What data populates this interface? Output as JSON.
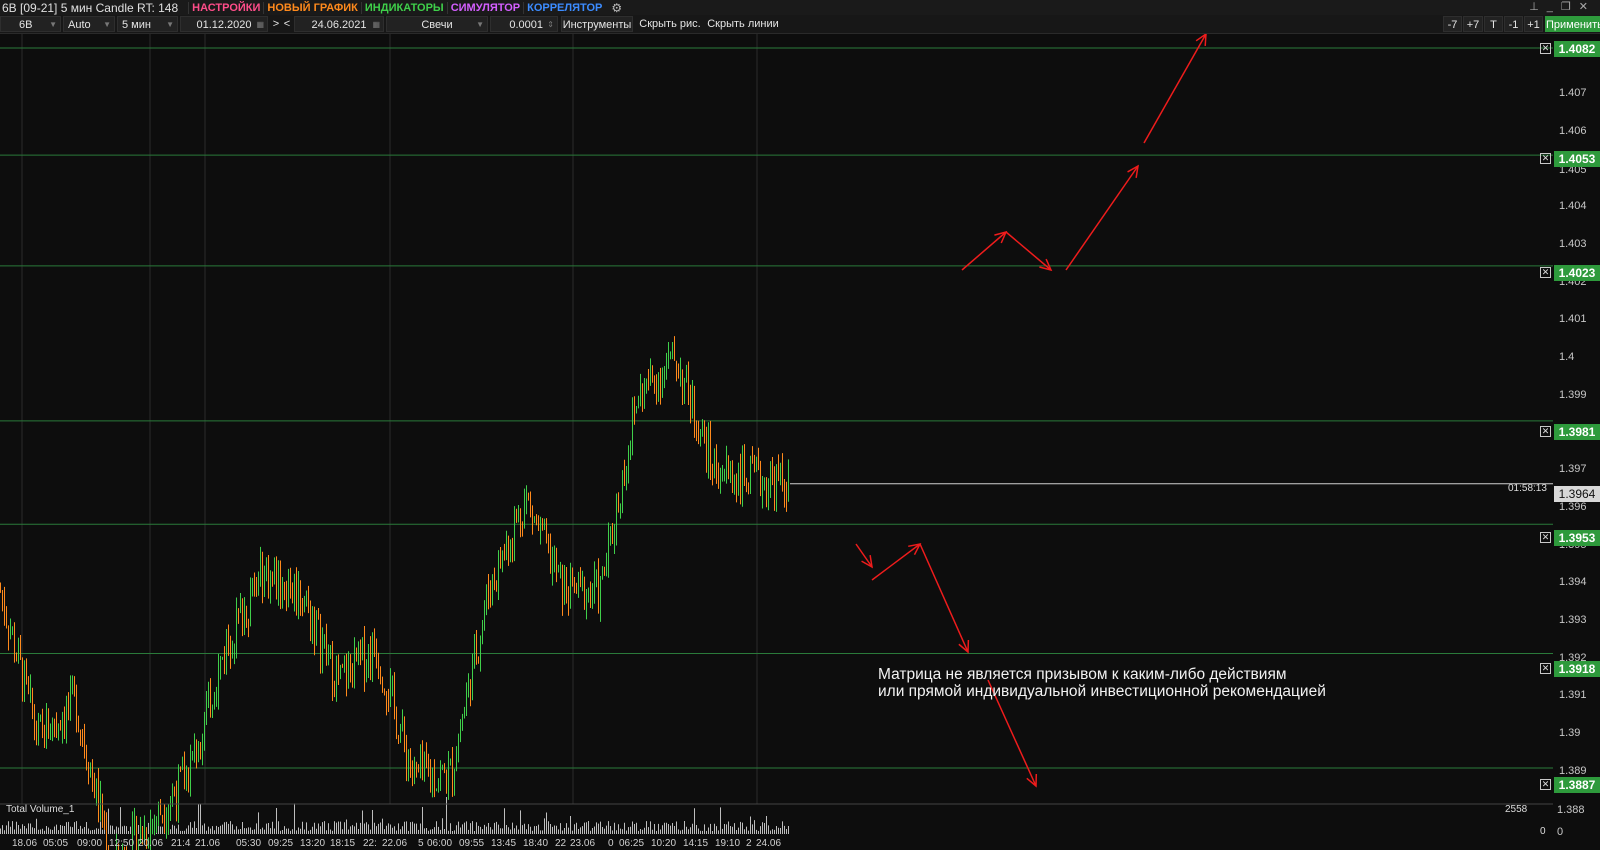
{
  "window": {
    "title": "6B [09-21] 5 мин Candle RT: 148",
    "menu": [
      {
        "label": "НАСТРОЙКИ",
        "color": "#ff4d8a"
      },
      {
        "label": "НОВЫЙ ГРАФИК",
        "color": "#ff8a1c"
      },
      {
        "label": "ИНДИКАТОРЫ",
        "color": "#3fcf4a"
      },
      {
        "label": "СИМУЛЯТОР",
        "color": "#d45fff"
      },
      {
        "label": "КОРРЕЛЯТОР",
        "color": "#3c8cff"
      }
    ],
    "settings_icon": "gears-icon",
    "controls": [
      "pin-icon",
      "minimize-icon",
      "restore-icon",
      "close-icon"
    ]
  },
  "toolbar": {
    "symbol": "6B",
    "scale": "Auto",
    "timeframe": "5 мин",
    "date_from": "01.12.2020",
    "nav_next": ">",
    "nav_prev": "<",
    "date_to": "24.06.2021",
    "chart_type": "Свечи",
    "tick_size": "0.0001",
    "tools_label": "Инструменты",
    "hide_drawings": "Скрыть рис.",
    "hide_lines": "Скрыть линии",
    "step_buttons": [
      "-7",
      "+7",
      "T",
      "-1",
      "+1"
    ],
    "apply_label": "Применить"
  },
  "price_axis": {
    "ticks": [
      "1.407",
      "1.406",
      "1.405",
      "1.404",
      "1.403",
      "1.402",
      "1.401",
      "1.4",
      "1.399",
      "1.397",
      "1.396",
      "1.395",
      "1.394",
      "1.393",
      "1.392",
      "1.391",
      "1.39",
      "1.389"
    ],
    "levels": [
      "1.4082",
      "1.4053",
      "1.4023",
      "1.3981",
      "1.3953",
      "1.3918",
      "1.3887"
    ],
    "current_price": "1.3964",
    "timer": "01:58:13"
  },
  "volume": {
    "label": "Total Volume_1",
    "max": "2558",
    "min": "0",
    "axis_ticks": [
      "1.388",
      "0"
    ]
  },
  "time_axis": [
    "18.06",
    "05:05",
    "09:00",
    "12:50",
    "20.06",
    "21:4",
    "21.06",
    "05:30",
    "09:25",
    "13:20",
    "18:15",
    "22:",
    "22.06",
    "5",
    "06:00",
    "09:55",
    "13:45",
    "18:40",
    "22",
    "23.06",
    "0",
    "06:25",
    "10:20",
    "14:15",
    "19:10",
    "2",
    "24.06"
  ],
  "disclaimer": {
    "line1": "Матрица не является призывом к каким-либо действиям",
    "line2": "или прямой индивидуальной инвестиционной рекомендацией"
  },
  "colors": {
    "level_badge": "#2e9a3c",
    "level_line": "#2a7a3a",
    "arrow": "#ee1c1c",
    "candle_up": "#3fcf4a",
    "candle_down": "#ff8a1c"
  },
  "chart_data": {
    "type": "candlestick",
    "instrument": "6B [09-21]",
    "timeframe": "5 мин",
    "y_axis_range": [
      1.388,
      1.4085
    ],
    "support_resistance_levels": [
      1.4082,
      1.4053,
      1.4023,
      1.3981,
      1.3953,
      1.3918,
      1.3887
    ],
    "current_price": 1.3964,
    "price_path_approx": [
      {
        "x": "18.06",
        "y": 1.3935
      },
      {
        "x": "05:05",
        "y": 1.3895
      },
      {
        "x": "09:00",
        "y": 1.3905
      },
      {
        "x": "12:50",
        "y": 1.386
      },
      {
        "x": "21.06",
        "y": 1.3872
      },
      {
        "x": "05:30",
        "y": 1.3885
      },
      {
        "x": "09:25",
        "y": 1.392
      },
      {
        "x": "13:20",
        "y": 1.394
      },
      {
        "x": "18:15",
        "y": 1.3935
      },
      {
        "x": "22:",
        "y": 1.391
      },
      {
        "x": "22.06",
        "y": 1.392
      },
      {
        "x": "06:00",
        "y": 1.3885
      },
      {
        "x": "09:55",
        "y": 1.3885
      },
      {
        "x": "13:45",
        "y": 1.3935
      },
      {
        "x": "18:40",
        "y": 1.396
      },
      {
        "x": "22",
        "y": 1.3935
      },
      {
        "x": "23.06",
        "y": 1.3935
      },
      {
        "x": "06:25",
        "y": 1.3988
      },
      {
        "x": "10:20",
        "y": 1.3998
      },
      {
        "x": "14:15",
        "y": 1.3968
      },
      {
        "x": "19:10",
        "y": 1.3965
      },
      {
        "x": "24.06",
        "y": 1.3964
      }
    ]
  }
}
